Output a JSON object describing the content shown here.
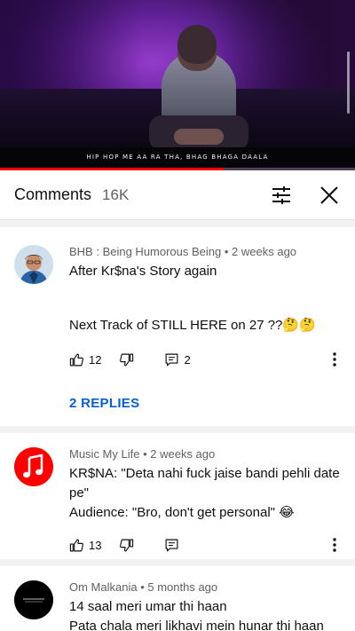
{
  "video": {
    "subtitle": "HIP HOP ME AA RA THA, BHAG BHAGA DAALA",
    "progress_fraction": 0.63
  },
  "comments_header": {
    "title": "Comments",
    "count": "16K",
    "filter_icon": "tune-icon",
    "close_icon": "close-icon"
  },
  "comments": [
    {
      "author": "BHB : Being Humorous Being",
      "time": "2 weeks ago",
      "text_line1": "After Kr$na's Story again",
      "text_line2": "Next Track of STILL HERE on 27 ??🤔🤔",
      "likes": "12",
      "replies_count": "2",
      "replies_link": "2 REPLIES",
      "avatar": "person-avatar"
    },
    {
      "author": "Music My Life",
      "time": "2 weeks ago",
      "text_line1": "KR$NA: \"Deta nahi fuck jaise bandi pehli date pe\"",
      "text_line2": "Audience: \"Bro, don't get personal\" 😂",
      "likes": "13",
      "avatar": "music-note-avatar",
      "accent": "#ff0000"
    },
    {
      "author": "Om Malkania",
      "time": "5 months ago",
      "text_line1": "14 saal meri umar thi haan",
      "text_line2": "Pata chala meri likhavi mein hunar thi haan",
      "avatar": "dark-logo-avatar"
    }
  ],
  "meta_separator": " • "
}
